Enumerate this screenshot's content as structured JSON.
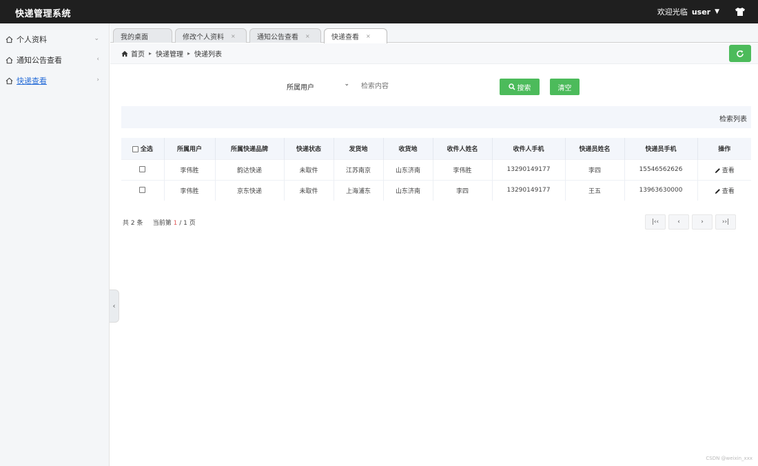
{
  "app": {
    "title": "快递管理系统",
    "welcome": "欢迎光临",
    "user": "user"
  },
  "sidebar": {
    "items": [
      {
        "label": "个人资料",
        "arrow": "⌄"
      },
      {
        "label": "通知公告查看",
        "arrow": "‹"
      },
      {
        "label": "快递查看",
        "arrow": "›"
      }
    ]
  },
  "tabs": [
    {
      "label": "我的桌面"
    },
    {
      "label": "修改个人资料"
    },
    {
      "label": "通知公告查看"
    },
    {
      "label": "快递查看"
    }
  ],
  "breadcrumb": {
    "home": "首页",
    "level1": "快递管理",
    "level2": "快递列表"
  },
  "search": {
    "select_value": "所属用户",
    "placeholder": "检索内容",
    "search_label": "搜索",
    "clear_label": "清空"
  },
  "list_title": "检索列表",
  "table": {
    "columns": [
      "全选",
      "所属用户",
      "所属快递品牌",
      "快递状态",
      "发货地",
      "收货地",
      "收件人姓名",
      "收件人手机",
      "快递员姓名",
      "快递员手机",
      "操作"
    ],
    "rows": [
      {
        "user": "李伟胜",
        "brand": "韵达快递",
        "status": "未取件",
        "from": "江苏南京",
        "to": "山东济南",
        "receiver": "李伟胜",
        "receiver_phone": "13290149177",
        "courier": "李四",
        "courier_phone": "15546562626",
        "action": "查看"
      },
      {
        "user": "李伟胜",
        "brand": "京东快递",
        "status": "未取件",
        "from": "上海浦东",
        "to": "山东济南",
        "receiver": "李四",
        "receiver_phone": "13290149177",
        "courier": "王五",
        "courier_phone": "13963630000",
        "action": "查看"
      }
    ]
  },
  "pager": {
    "total": "共 2 条",
    "current_prefix": "当前第",
    "current": "1",
    "current_suffix": "/ 1 页",
    "first": "|‹‹",
    "prev": "‹",
    "next": "›",
    "last": "››|"
  },
  "watermark": "CSDN @weixin_xxx",
  "colors": {
    "topbar": "#1f1f1f",
    "accent_green": "#4cbb5b",
    "link_blue": "#2a6fd8",
    "page_red": "#e05858"
  }
}
